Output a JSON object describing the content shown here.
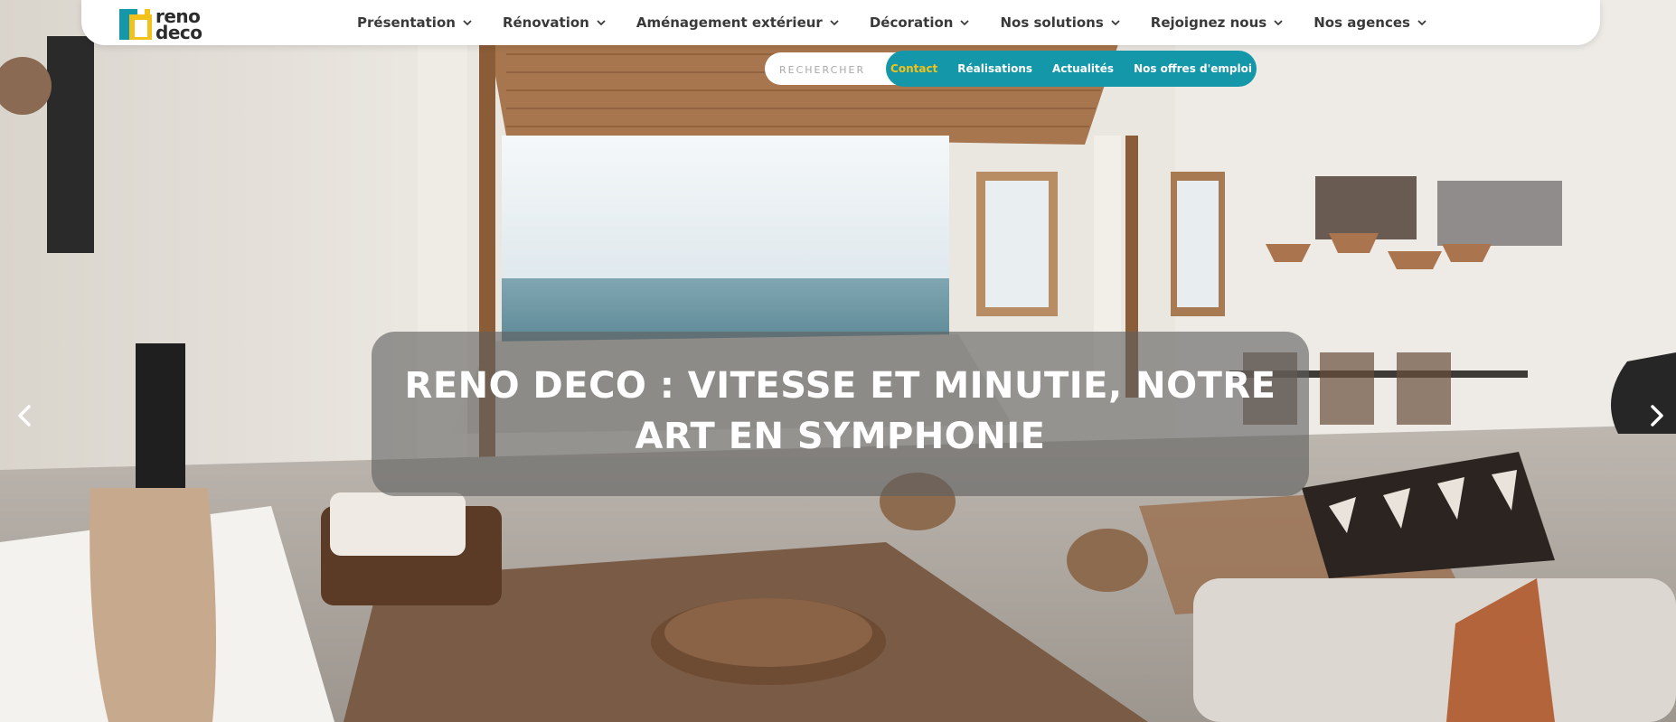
{
  "brand": {
    "logo_line1": "reno",
    "logo_line2": "deco",
    "colors": {
      "yellow": "#f2c21a",
      "teal": "#1497a8",
      "dark": "#2c2c2c"
    }
  },
  "nav": {
    "items": [
      {
        "label": "Présentation"
      },
      {
        "label": "Rénovation"
      },
      {
        "label": "Aménagement extérieur"
      },
      {
        "label": "Décoration"
      },
      {
        "label": "Nos solutions"
      },
      {
        "label": "Rejoignez nous"
      },
      {
        "label": "Nos agences"
      }
    ]
  },
  "search": {
    "placeholder": "RECHERCHER"
  },
  "subnav": {
    "links": [
      {
        "label": "Contact"
      },
      {
        "label": "Réalisations"
      },
      {
        "label": "Actualités"
      },
      {
        "label": "Nos offres d'emploi"
      }
    ]
  },
  "slider": {
    "title_line1": "RENO DECO : VITESSE ET MINUTIE, NOTRE",
    "title_line2": "ART EN SYMPHONIE",
    "prev_icon": "chevron-left-icon",
    "next_icon": "chevron-right-icon"
  }
}
